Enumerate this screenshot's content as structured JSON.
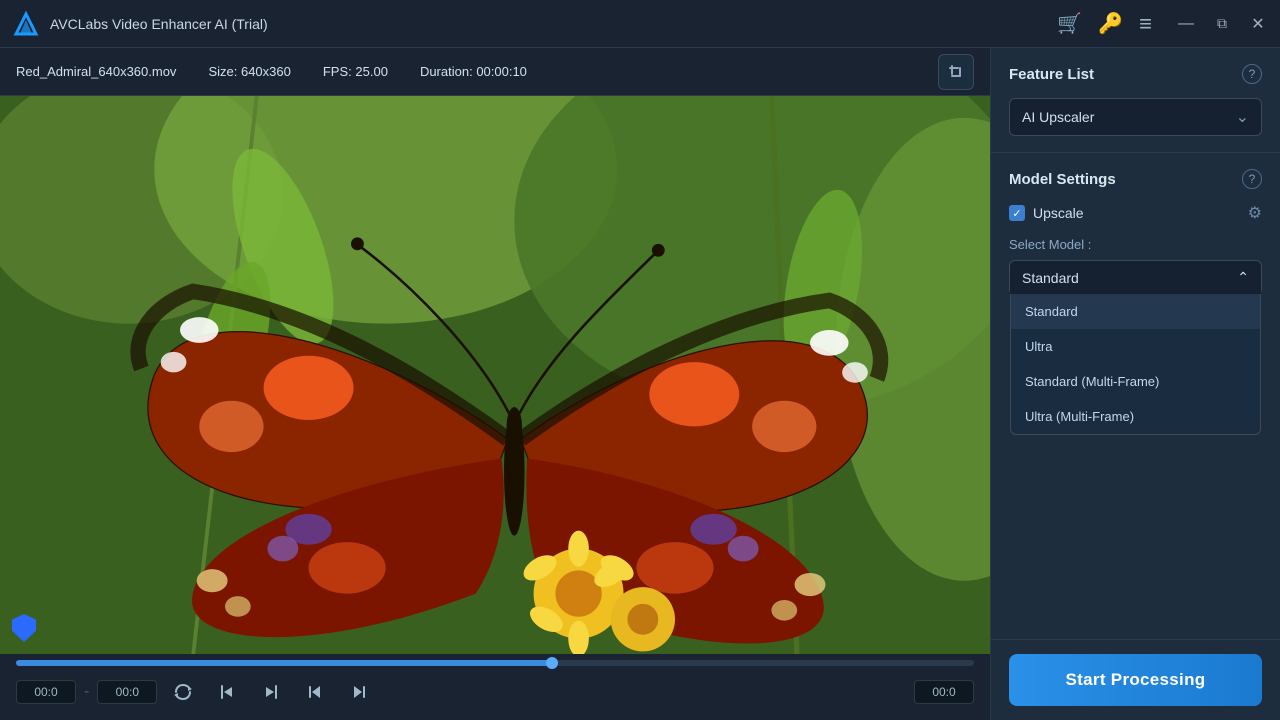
{
  "app": {
    "title": "AVCLabs Video Enhancer AI (Trial)"
  },
  "titleBar": {
    "title": "AVCLabs Video Enhancer AI (Trial)",
    "icons": {
      "cart": "🛒",
      "key": "🔑",
      "menu": "≡",
      "minimize": "—",
      "maximize": "⧉",
      "close": "✕"
    }
  },
  "fileInfo": {
    "filename": "Red_Admiral_640x360.mov",
    "sizeLabel": "Size:",
    "sizeValue": "640x360",
    "fpsLabel": "FPS:",
    "fpsValue": "25.00",
    "durationLabel": "Duration:",
    "durationValue": "00:00:10"
  },
  "videoControls": {
    "timeStart": "00:0",
    "separator": "-",
    "timeEnd": "00:0",
    "timeRight": "00:0",
    "progressPercent": 56
  },
  "rightPanel": {
    "featureList": {
      "title": "Feature List",
      "selectedFeature": "AI Upscaler"
    },
    "modelSettings": {
      "title": "Model Settings",
      "upscaleLabel": "Upscale",
      "selectModelLabel": "Select Model :",
      "selectedModel": "Standard",
      "modelOptions": [
        {
          "value": "Standard",
          "label": "Standard"
        },
        {
          "value": "Ultra",
          "label": "Ultra"
        },
        {
          "value": "Standard (Multi-Frame)",
          "label": "Standard (Multi-Frame)"
        },
        {
          "value": "Ultra (Multi-Frame)",
          "label": "Ultra (Multi-Frame)"
        }
      ]
    },
    "startButton": {
      "label": "Start Processing"
    }
  }
}
